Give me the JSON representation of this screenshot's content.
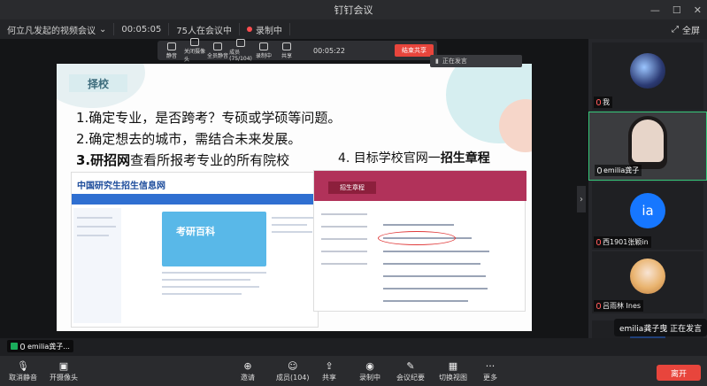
{
  "window": {
    "title": "钉钉会议"
  },
  "infobar": {
    "meeting_name": "何立凡发起的视频会议",
    "duration": "00:05:05",
    "attendance": "75人在会议中",
    "recording": "录制中",
    "fullscreen": "全屏"
  },
  "share_toolbar": {
    "items": [
      "静音",
      "关闭摄像头",
      "全员静音",
      "成员(75/104)",
      "录制中",
      "共享"
    ],
    "time": "00:05:22",
    "end_label": "结束共享",
    "speaker_label": "正在发言"
  },
  "slide": {
    "tag": "择校",
    "line1": "1.确定专业，是否跨考？专硕或学硕等问题。",
    "line2": "2.确定想去的城市，需结合未来发展。",
    "line3_bold": "3.研招网",
    "line3_rest": "查看所报考专业的所有院校",
    "line4_rest": "4. 目标学校官网一",
    "line4_bold": "招生章程",
    "site1_logo": "中国研究生招生信息网",
    "site1_banner": "考研百科",
    "site2_label": "招生章程"
  },
  "participants": [
    {
      "name": "我",
      "muted": false
    },
    {
      "name": "emilia龚子",
      "muted": false
    },
    {
      "name": "西1901张颖in",
      "muted": true,
      "initials": "ia"
    },
    {
      "name": "吕雨林 Ines",
      "muted": true
    }
  ],
  "speaking": "emilia龚子曳  正在发言",
  "self_tag": "emilia龚子...",
  "toolbar": {
    "unmute": "取消静音",
    "camera": "开摄像头",
    "invite": "邀请",
    "members": "成员(104)",
    "share": "共享",
    "recording": "录制中",
    "minutes": "会议纪要",
    "switch_view": "切换视图",
    "more": "更多",
    "leave": "离开"
  },
  "colors": {
    "accent": "#e8453c",
    "active_border": "#36c97a",
    "avatar_blue": "#1677ff"
  }
}
